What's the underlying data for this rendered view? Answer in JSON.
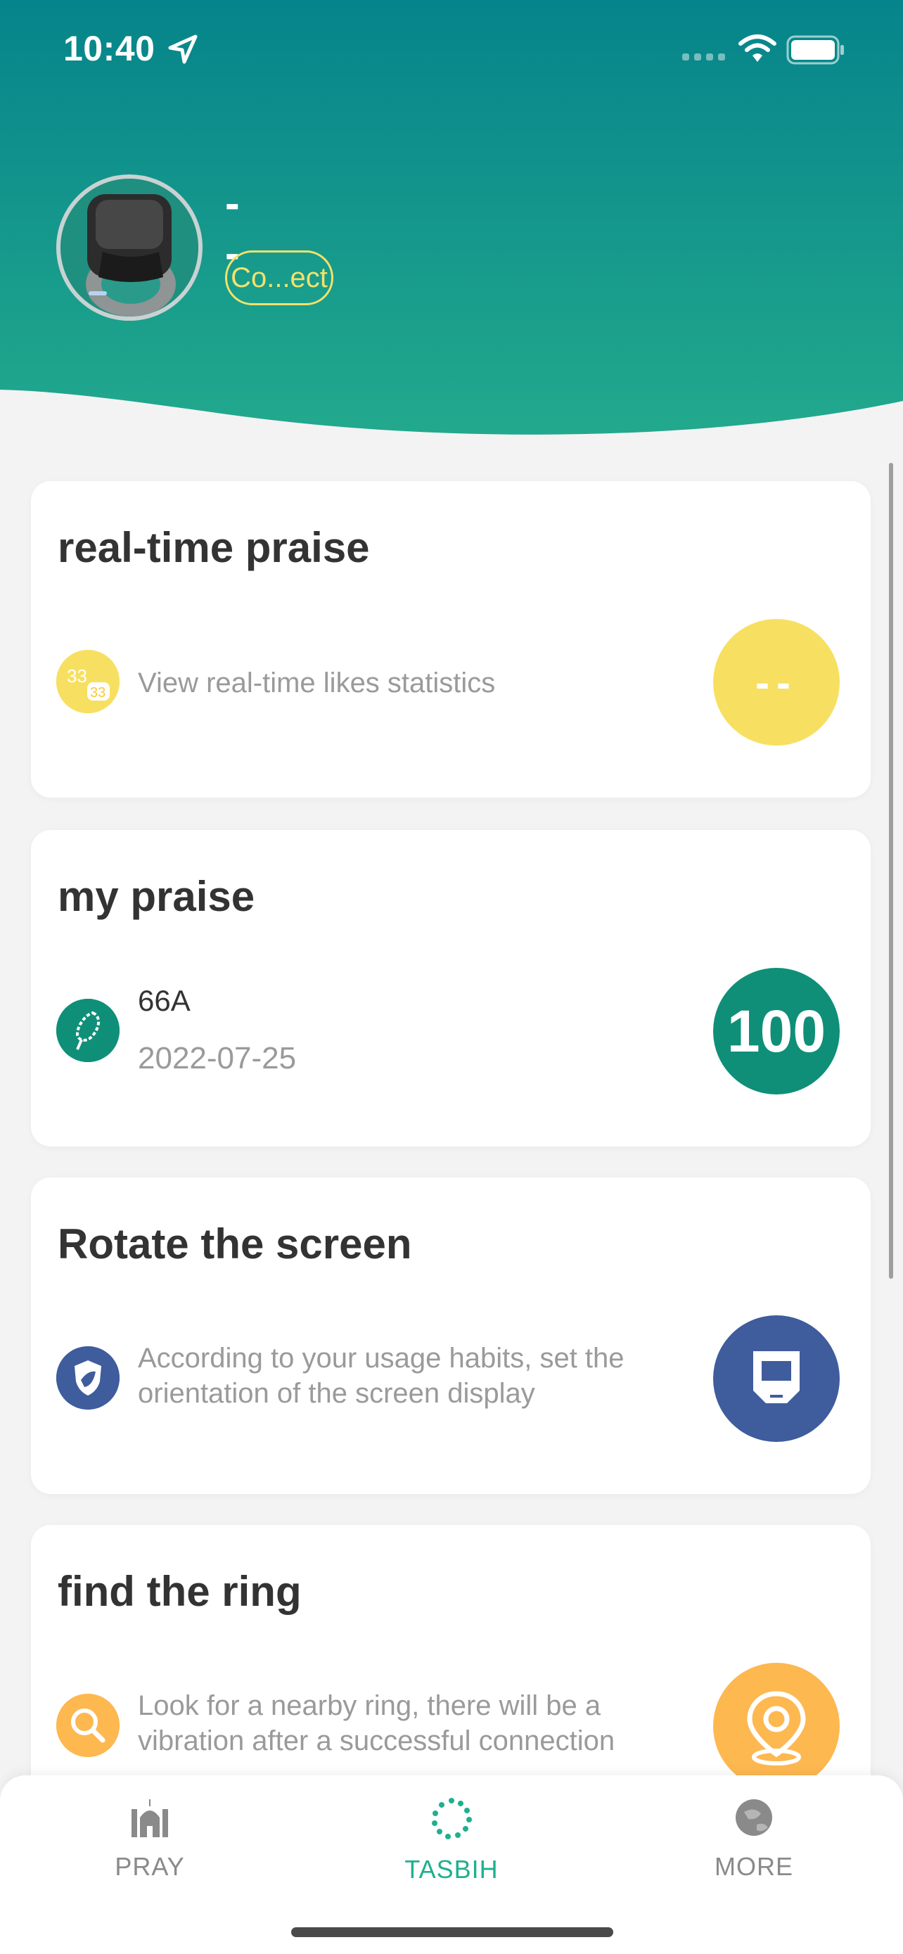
{
  "status_bar": {
    "time": "10:40"
  },
  "profile": {
    "device_name": "--",
    "connect_label": "Co...ect"
  },
  "cards": [
    {
      "title": "real-time praise",
      "description": "View real-time likes statistics",
      "badge": "--",
      "icon_text": "33",
      "icon_text_small": "33",
      "color": "#f7e061"
    },
    {
      "title": "my praise",
      "item_name": "66A",
      "date": "2022-07-25",
      "badge": "100",
      "color": "#0f8f78"
    },
    {
      "title": "Rotate the screen",
      "description_line1": "According to your usage habits, set the",
      "description_line2": "orientation of the screen display",
      "color": "#3f5c9c"
    },
    {
      "title": "find the ring",
      "description_line1": "Look for a nearby ring, there will be a",
      "description_line2": "vibration after a successful connection",
      "color": "#fdb850"
    }
  ],
  "tabs": [
    {
      "label": "PRAY",
      "active": false
    },
    {
      "label": "TASBIH",
      "active": true
    },
    {
      "label": "MORE",
      "active": false
    }
  ],
  "colors": {
    "header_top": "#06848b",
    "header_bottom": "#22a98d",
    "active_tab": "#1eb08f",
    "inactive_tab": "#8a8a8a"
  }
}
